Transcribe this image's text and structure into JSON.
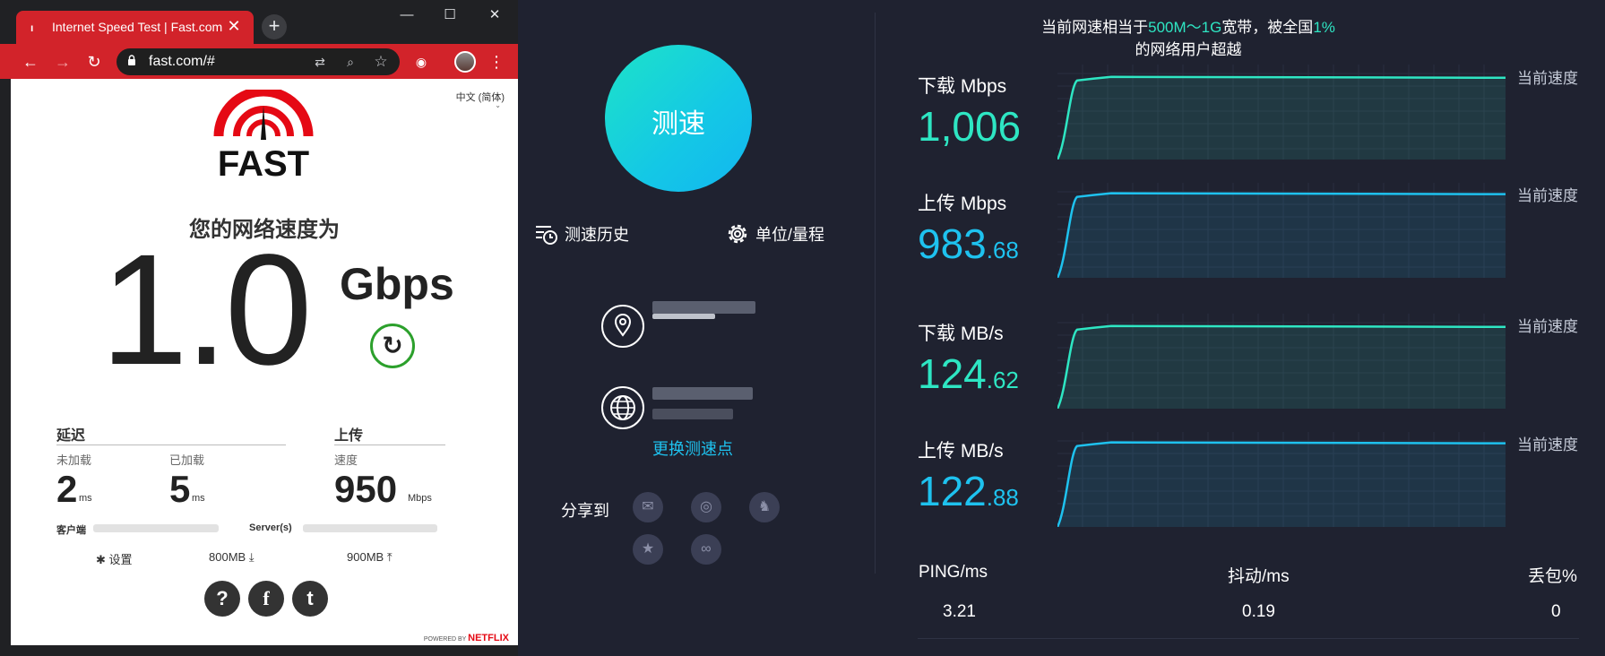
{
  "browser": {
    "tab_title": "Internet Speed Test | Fast.com",
    "tab_close": "✕",
    "new_tab": "+",
    "url": "fast.com/#",
    "window_controls": {
      "minimize": "—",
      "maximize": "☐",
      "close": "✕"
    },
    "nav": {
      "back": "←",
      "forward": "→",
      "reload": "↻"
    },
    "omnibox_icons": [
      "translate-icon",
      "zoom-icon",
      "star-icon"
    ],
    "menu": "⋮",
    "accent": "#d2232a"
  },
  "fast": {
    "language": "中文 (简体)",
    "logo_text": "FAST",
    "heading": "您的网络速度为",
    "speed": "1.0",
    "unit": "Gbps",
    "reload_glyph": "↻",
    "latency": {
      "title": "延迟",
      "unloaded_label": "未加载",
      "unloaded_value": "2",
      "unloaded_unit": "ms",
      "loaded_label": "已加载",
      "loaded_value": "5",
      "loaded_unit": "ms"
    },
    "upload": {
      "title": "上传",
      "speed_label": "速度",
      "value": "950",
      "unit": "Mbps"
    },
    "client_label": "客户端",
    "server_label": "Server(s)",
    "settings_label": "设置",
    "settings_glyph": "✱",
    "data_down": "800MB",
    "data_up": "900MB",
    "social": {
      "help": "?",
      "facebook": "f",
      "twitter": "t"
    },
    "powered_by": "POWERED BY",
    "netflix": "NETFLIX",
    "accent_green": "#2ca02c"
  },
  "app": {
    "start_button": "测速",
    "history": "测速历史",
    "units": "单位/量程",
    "switch_node": "更换测速点",
    "share_label": "分享到",
    "share_icons": [
      "wechat-icon",
      "weibo-icon",
      "qq-icon",
      "favorite-icon",
      "link-icon"
    ],
    "banner": {
      "prefix": "当前网速相当于",
      "tier": "500M～1G",
      "middle": "宽带，被全国",
      "percent": "1%",
      "suffix": "的网络用户超越"
    },
    "rows": [
      {
        "label": "下载 Mbps",
        "int": "1,006",
        "dec": "",
        "color": "#2ee6c3",
        "current": "当前速度",
        "level": 0.87
      },
      {
        "label": "上传 Mbps",
        "int": "983",
        "dec": ".68",
        "color": "#1ec2ef",
        "current": "当前速度",
        "level": 0.89
      },
      {
        "label": "下载 MB/s",
        "int": "124",
        "dec": ".62",
        "color": "#2ee6c3",
        "current": "当前速度",
        "level": 0.87
      },
      {
        "label": "上传 MB/s",
        "int": "122",
        "dec": ".88",
        "color": "#1ec2ef",
        "current": "当前速度",
        "level": 0.89
      }
    ],
    "stats": {
      "ping_label": "PING/ms",
      "ping_value": "3.21",
      "jitter_label": "抖动/ms",
      "jitter_value": "0.19",
      "loss_label": "丢包%",
      "loss_value": "0"
    },
    "colors": {
      "background": "#1f2230",
      "green": "#2ee6c3",
      "blue": "#1ec2ef"
    }
  }
}
